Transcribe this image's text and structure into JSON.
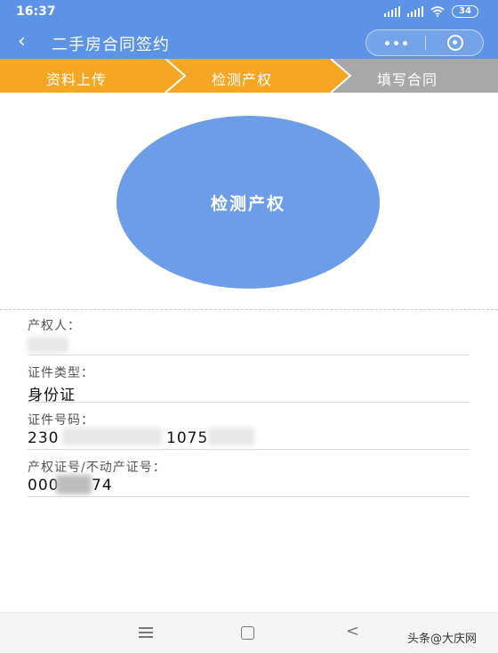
{
  "status_bar": {
    "time": "16:37",
    "battery": "34"
  },
  "nav": {
    "back_icon": "‹",
    "title": "二手房合同签约"
  },
  "steps": {
    "items": [
      {
        "label": "资料上传",
        "color": "#f5a623"
      },
      {
        "label": "检测产权",
        "color": "#f5a623"
      },
      {
        "label": "填写合同",
        "color": "#a8a8a8"
      }
    ]
  },
  "main": {
    "check_button": "检测产权",
    "button_color": "#6d9de8"
  },
  "fields": [
    {
      "label": "产权人：",
      "value": ""
    },
    {
      "label": "证件类型：",
      "value": "身份证"
    },
    {
      "label": "证件号码：",
      "value_prefix": "230",
      "value_middle": "1075"
    },
    {
      "label": "产权证号/不动产证号：",
      "value_prefix": "000",
      "value_suffix": "74"
    }
  ],
  "footer": {
    "watermark": "头条@大庆网"
  },
  "colors": {
    "brand_blue": "#5d93e6",
    "active_step": "#f5a623",
    "inactive_step": "#a8a8a8"
  }
}
